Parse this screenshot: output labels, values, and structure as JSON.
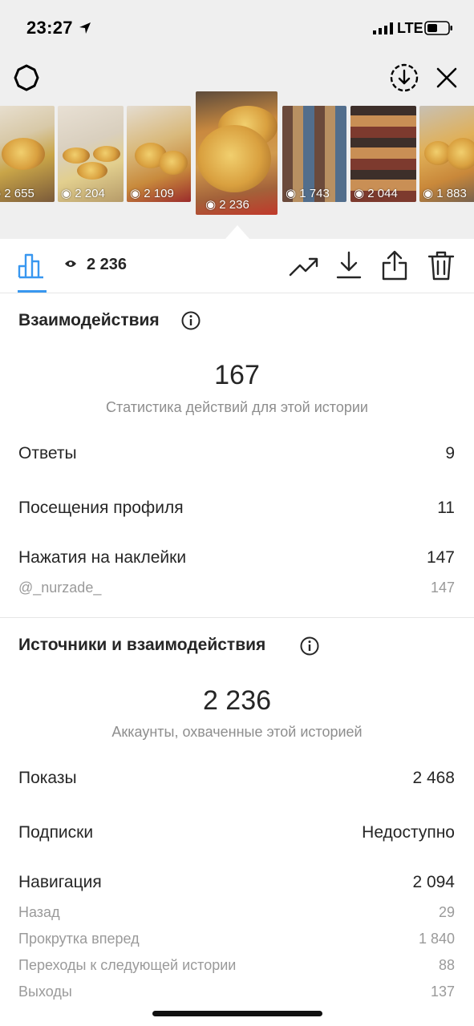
{
  "status_bar": {
    "time": "23:27",
    "network": "LTE"
  },
  "thumbnails": [
    {
      "views": "2 655"
    },
    {
      "views": "2 204"
    },
    {
      "views": "2 109"
    },
    {
      "views": "2 236"
    },
    {
      "views": "1 743"
    },
    {
      "views": "2 044"
    },
    {
      "views": "1 883"
    }
  ],
  "stats_bar": {
    "views": "2 236"
  },
  "interactions": {
    "title": "Взаимодействия",
    "total": "167",
    "caption": "Статистика действий для этой истории",
    "rows": [
      {
        "label": "Ответы",
        "value": "9"
      },
      {
        "label": "Посещения профиля",
        "value": "11"
      },
      {
        "label": "Нажатия на наклейки",
        "value": "147"
      }
    ],
    "sticker": {
      "label": "@_nurzade_",
      "value": "147"
    }
  },
  "discovery": {
    "title": "Источники и взаимодействия",
    "total": "2 236",
    "caption": "Аккаунты, охваченные этой историей",
    "rows": [
      {
        "label": "Показы",
        "value": "2 468"
      },
      {
        "label": "Подписки",
        "value": "Недоступно"
      },
      {
        "label": "Навигация",
        "value": "2 094"
      }
    ],
    "navigation": [
      {
        "label": "Назад",
        "value": "29"
      },
      {
        "label": "Прокрутка вперед",
        "value": "1 840"
      },
      {
        "label": "Переходы к следующей истории",
        "value": "88"
      },
      {
        "label": "Выходы",
        "value": "137"
      }
    ]
  },
  "colors": {
    "accent": "#3897f0",
    "text": "#262626",
    "secondary": "#8e8e8e",
    "toolbar_bg": "#efefef"
  },
  "icons": [
    "gear-icon",
    "save-icon",
    "close-icon",
    "eye-icon",
    "bar-chart-icon",
    "trend-icon",
    "download-icon",
    "share-icon",
    "trash-icon",
    "info-icon"
  ]
}
